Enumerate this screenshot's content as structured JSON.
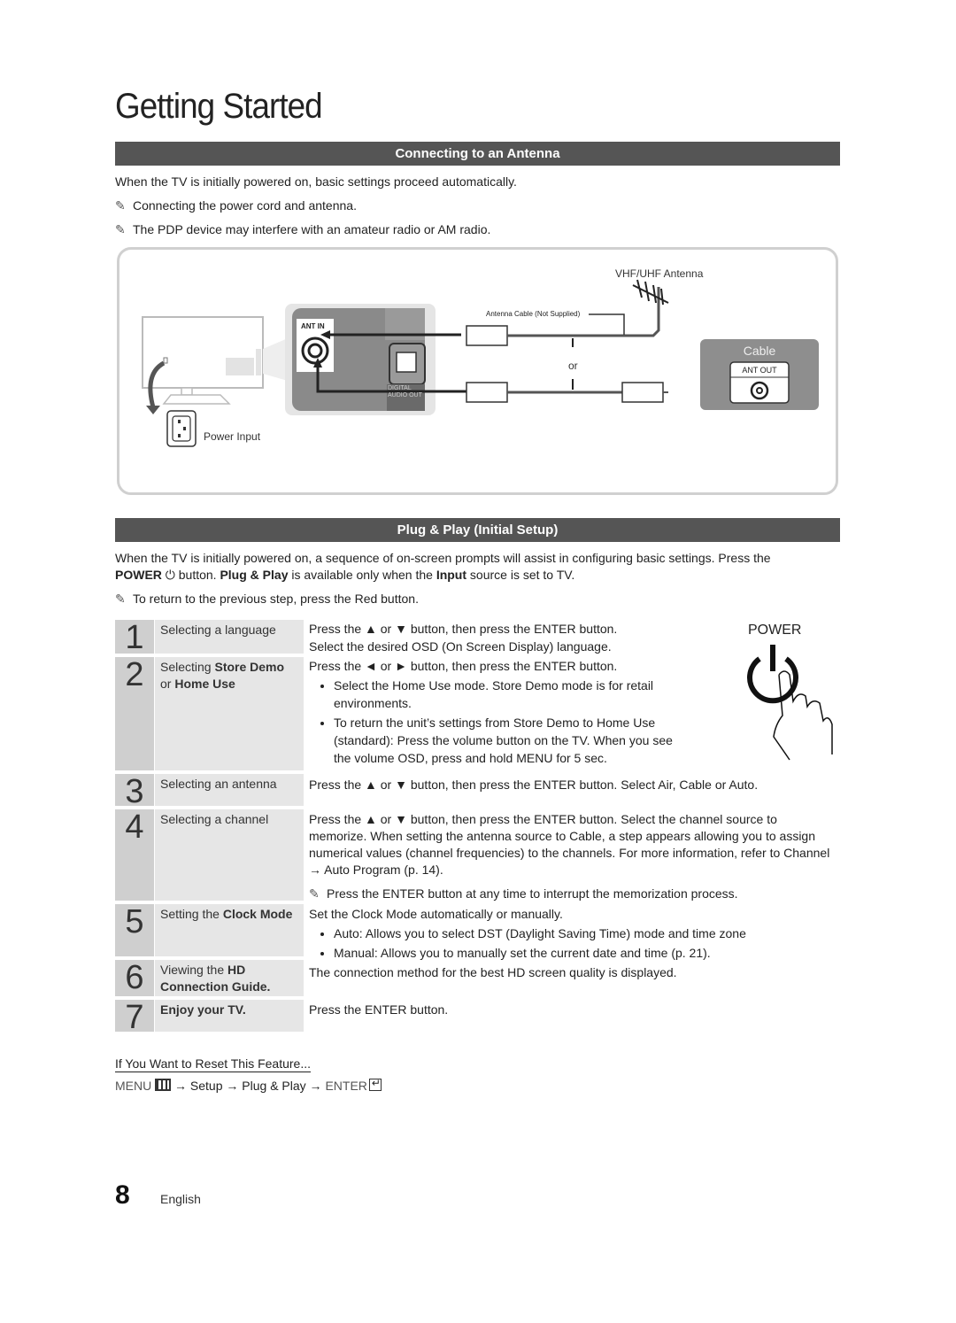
{
  "page": {
    "title": "Getting Started",
    "page_number": "8",
    "language": "English"
  },
  "antenna_section": {
    "header": "Connecting to an Antenna",
    "intro": "When the TV is initially powered on, basic settings proceed automatically.",
    "notes": [
      "Connecting the power cord and antenna.",
      "The PDP device may interfere with an amateur radio or AM radio."
    ],
    "diagram": {
      "ant_in_label": "ANT IN",
      "digital_audio_label": "DIGITAL AUDIO OUT",
      "power_input_label": "Power Input",
      "antenna_label": "VHF/UHF Antenna",
      "cable_note": "Antenna Cable (Not Supplied)",
      "or_label": "or",
      "cable_box_title": "Cable",
      "ant_out_label": "ANT OUT"
    }
  },
  "plug_play_section": {
    "header": "Plug & Play (Initial Setup)",
    "intro_1": "When the TV is initially powered on, a sequence of on-screen prompts will assist in configuring basic settings. Press the",
    "intro_power": "POWER",
    "intro_2": " button. ",
    "intro_plug": "Plug & Play",
    "intro_3": " is available only when the ",
    "intro_input": "Input",
    "intro_4": " source is set to TV.",
    "note": "To return to the previous step, press the Red button.",
    "power_graphic_label": "POWER",
    "steps": [
      {
        "number": "1",
        "label": "Selecting a language",
        "lines": [
          "Press the ▲ or ▼ button, then press the ENTER button.",
          "Select the desired OSD (On Screen Display) language."
        ]
      },
      {
        "number": "2",
        "label_pre": "Selecting ",
        "label_b1": "Store Demo",
        "label_mid": " or ",
        "label_b2": "Home Use",
        "line1": "Press the ◄ or ► button, then press the ENTER button.",
        "bullet1": "Select the Home Use mode. Store Demo mode is for retail environments.",
        "bullet2": "To return the unit’s settings from Store Demo to Home Use (standard): Press the volume button on the TV. When you see the volume OSD, press and hold MENU for 5 sec."
      },
      {
        "number": "3",
        "label": "Selecting an antenna",
        "line1": "Press the ▲ or ▼ button, then press the ENTER button. Select Air, Cable or Auto."
      },
      {
        "number": "4",
        "label": "Selecting a channel",
        "line1": "Press the ▲ or ▼ button, then press the ENTER button. Select the channel source to memorize. When setting the antenna source to Cable, a step appears allowing you to assign numerical values (channel frequencies) to the channels. For more information, refer to Channel → Auto Program (p. 14).",
        "note": "Press the ENTER button at any time to interrupt the memorization process."
      },
      {
        "number": "5",
        "label_pre": "Setting the ",
        "label_b1": "Clock Mode",
        "line1": "Set the Clock Mode automatically or manually.",
        "bullet1": "Auto: Allows you to select DST (Daylight Saving Time) mode and time zone",
        "bullet2": "Manual: Allows you to manually set the current date and time (p. 21)."
      },
      {
        "number": "6",
        "label_pre": "Viewing the ",
        "label_b1": "HD Connection Guide.",
        "line1": "The connection method for the best HD screen quality is displayed."
      },
      {
        "number": "7",
        "label": "Enjoy your TV.",
        "line1": "Press the ENTER button."
      }
    ],
    "reset": {
      "title": "If You Want to Reset This Feature...",
      "menu": "MENU",
      "arrow": "→",
      "setup": "Setup",
      "plug": "Plug & Play",
      "enter": "ENTER"
    }
  }
}
